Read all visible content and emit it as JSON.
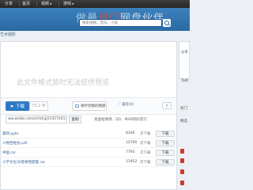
{
  "nav": {
    "items": [
      "分享",
      "首页",
      "视频",
      "游戏"
    ],
    "has_caret": [
      false,
      false,
      true,
      true
    ]
  },
  "banner": {
    "slogan_a": "做最",
    "slogan_b": "热门",
    "slogan_c": "网盘伙伴",
    "search_placeholder": "搜索视频、音乐、小说"
  },
  "breadcrumb": "艺术摄影",
  "preview": {
    "message": "此文件格式暂时无法提供预览"
  },
  "actions": {
    "download_label": "下载",
    "size": "71.2 M",
    "save_label": "保存到我的网盘",
    "favorite_label": "喜欢(0)"
  },
  "share": {
    "link": "ww.weibo.com/s/mEqjV1357441721",
    "copy_label": "复制",
    "hint": "发送给微博、QQ、MSN等好友们"
  },
  "files": [
    {
      "name": "第四.pptx",
      "count": "8346",
      "unit": "次下载",
      "btn": "下载"
    },
    {
      "name": "人物百姓仿.pdf",
      "count": "10790",
      "unit": "次下载",
      "btn": "下载"
    },
    {
      "name": "中国.rar",
      "count": "7793",
      "unit": "次下载",
      "btn": "下载"
    },
    {
      "name": "小学文化30卷拼卷配套.rar",
      "count": "11952",
      "unit": "次下载",
      "btn": "下载"
    }
  ],
  "sidebar": {
    "label_top": "分享",
    "label_mid": "Ta的",
    "label_a": "热门",
    "label_b": "精选"
  },
  "colors": {
    "nav_bg": "#2f2f2f",
    "banner_bg": "#2a6aa3",
    "download_btn": "#2d7ac4",
    "link": "#2d5f9a",
    "pdf": "#c73a2f"
  }
}
